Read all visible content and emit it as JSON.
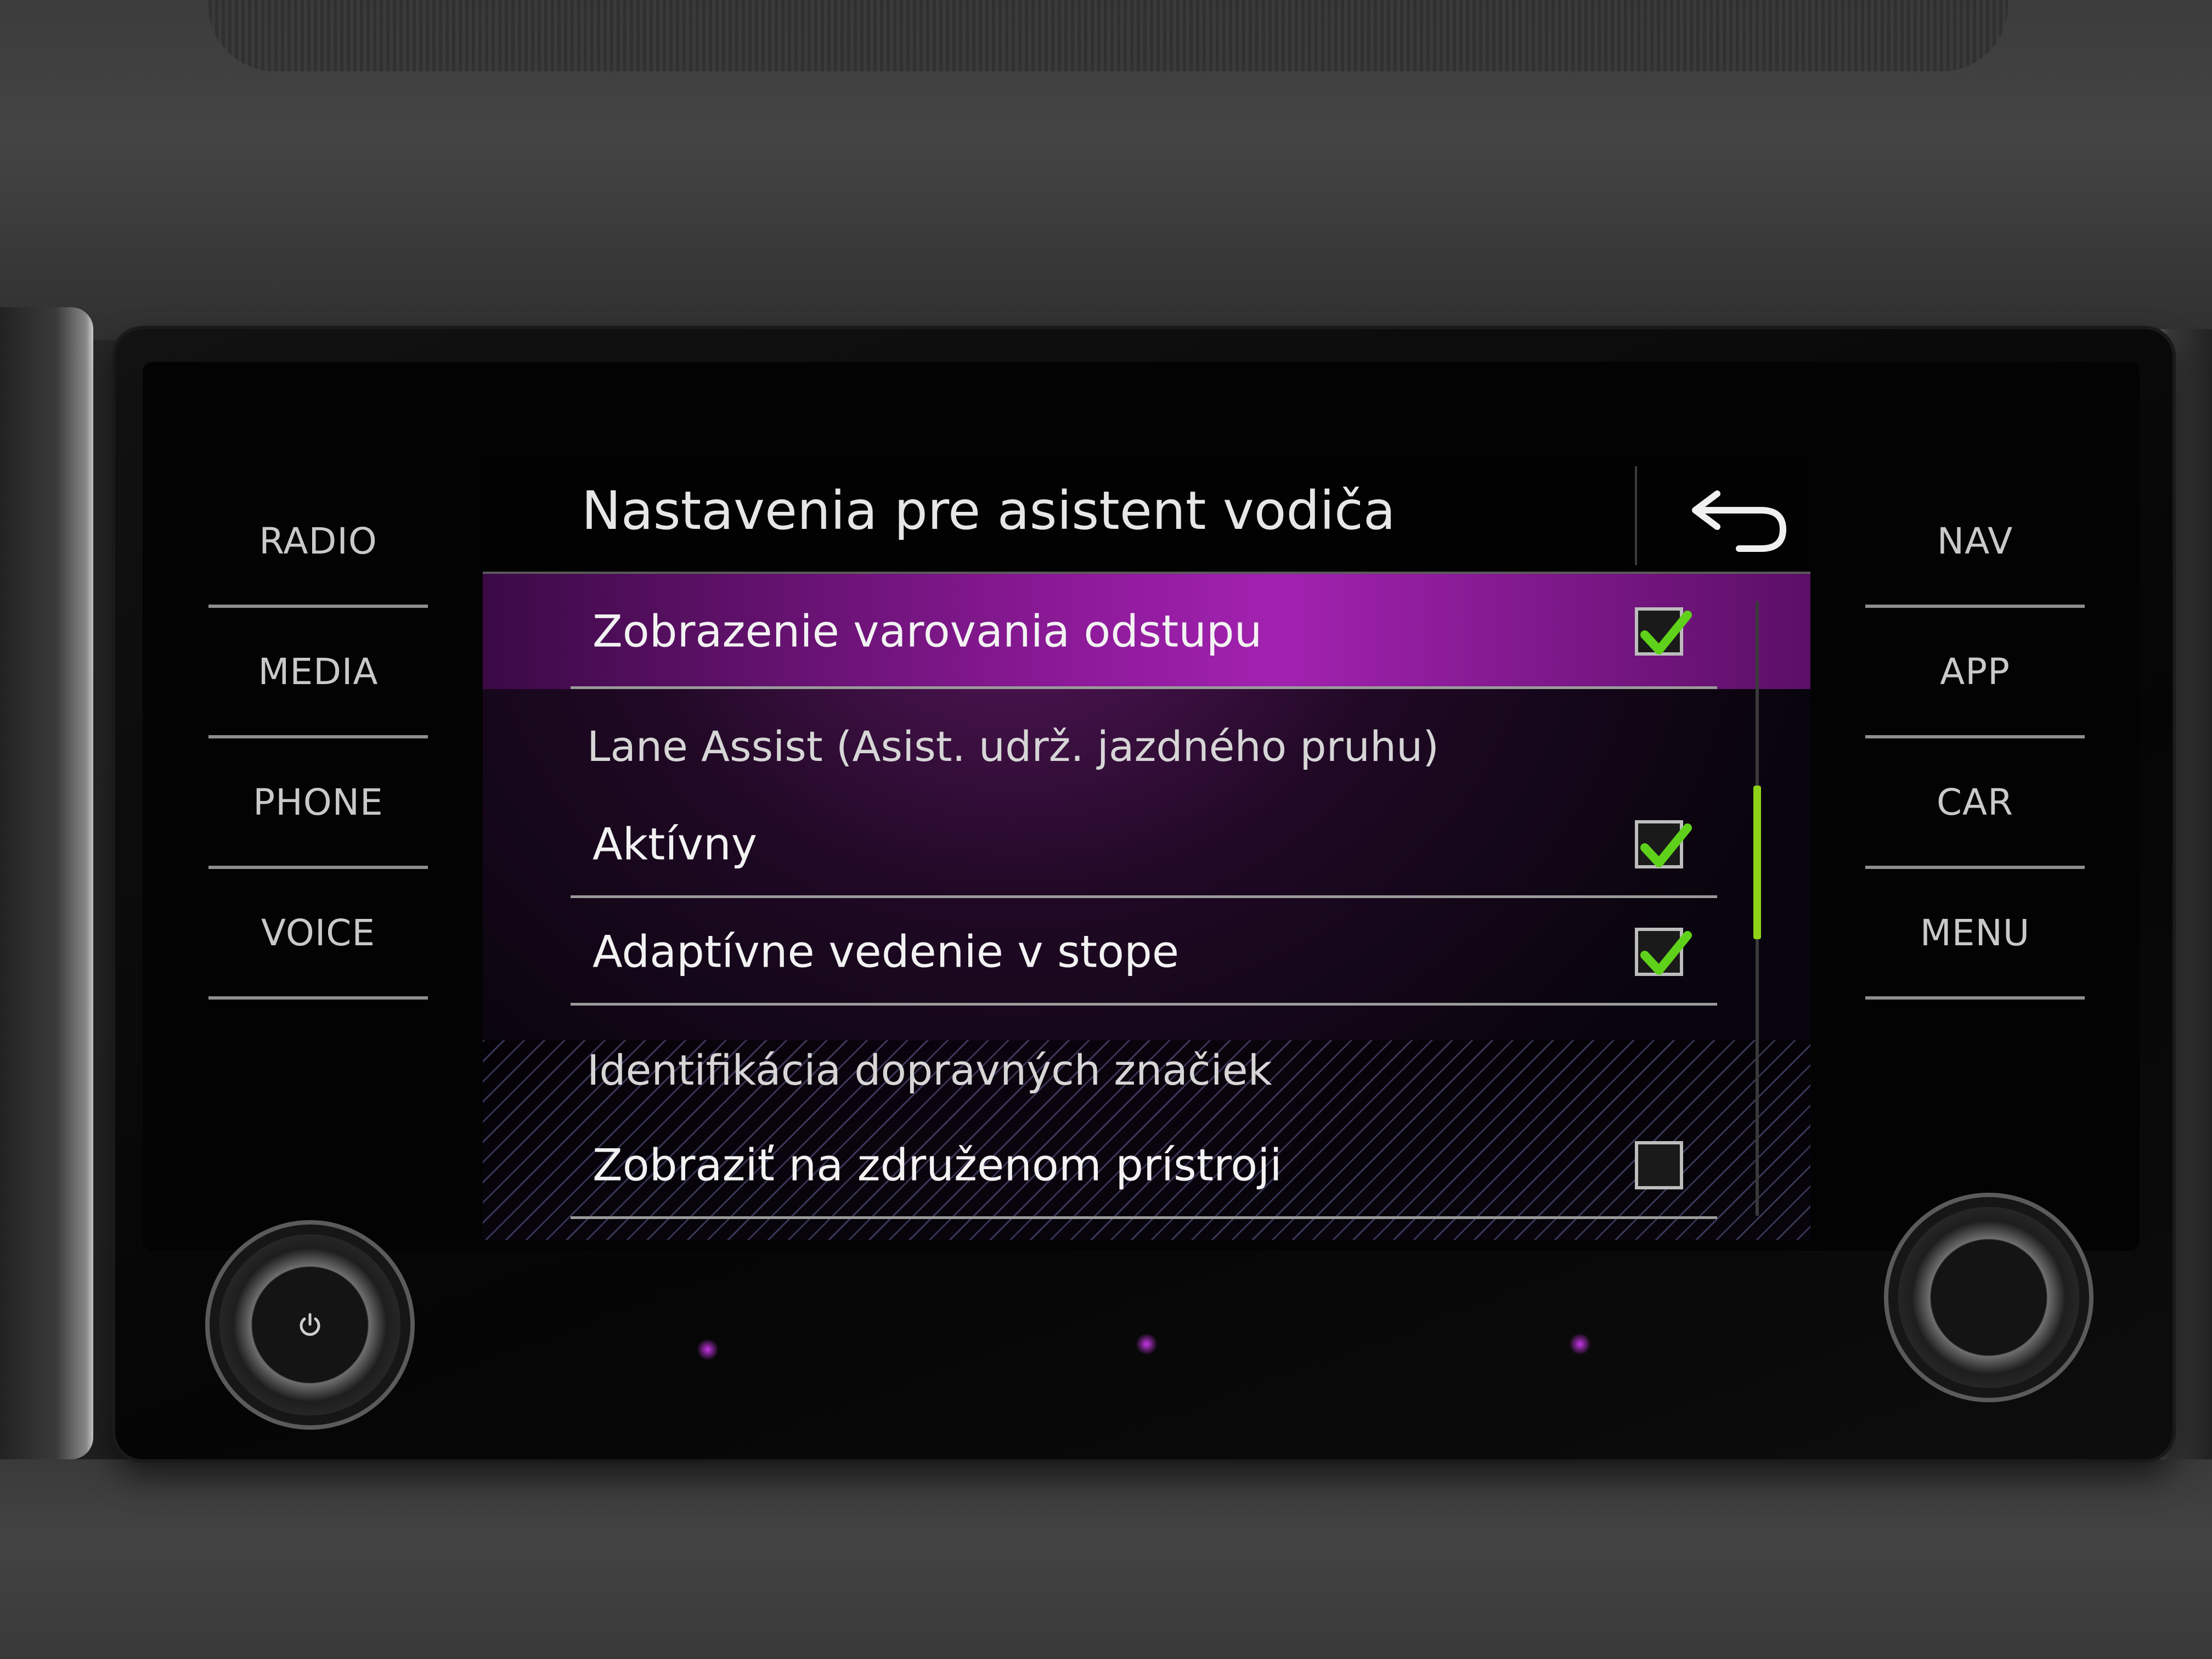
{
  "left_keys": [
    {
      "label": "RADIO"
    },
    {
      "label": "MEDIA"
    },
    {
      "label": "PHONE"
    },
    {
      "label": "VOICE"
    }
  ],
  "right_keys": [
    {
      "label": "NAV"
    },
    {
      "label": "APP"
    },
    {
      "label": "CAR"
    },
    {
      "label": "MENU"
    }
  ],
  "screen": {
    "title": "Nastavenia pre asistent vodiča",
    "back_icon": "back-arrow-icon",
    "items": [
      {
        "label": "Zobrazenie varovania odstupu",
        "checked": true,
        "selected": true
      },
      {
        "label": "Aktívny",
        "checked": true
      },
      {
        "label": "Adaptívne vedenie v stope",
        "checked": true
      },
      {
        "label": "Zobraziť na združenom prístroji",
        "checked": false
      }
    ],
    "sections": [
      {
        "label": "Lane Assist (Asist. udrž. jazdného pruhu)"
      },
      {
        "label": "Identifikácia dopravných značiek"
      }
    ],
    "scroll_position": 0.4,
    "scroll_fraction": 0.25
  },
  "colors": {
    "highlight": "#a222b0",
    "check": "#5fd11a",
    "scroll_thumb": "#8fd21a"
  },
  "icons": {
    "power": "power-icon",
    "check": "checkmark-icon"
  }
}
